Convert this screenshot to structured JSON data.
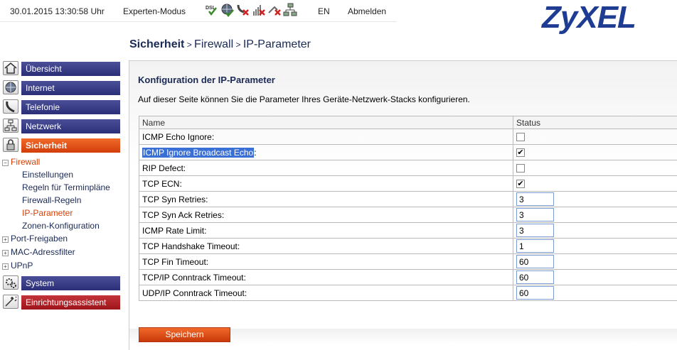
{
  "topbar": {
    "datetime": "30.01.2015 13:30:58 Uhr",
    "mode": "Experten-Modus",
    "status_icons": [
      "dsl-icon",
      "internet-icon",
      "phone-disconnected-icon",
      "wifi-disabled-icon",
      "network-disabled-icon",
      "lan-icon"
    ],
    "language": "EN",
    "logout": "Abmelden"
  },
  "brand": {
    "logo_text": "ZyXEL",
    "color": "#1f3c93"
  },
  "breadcrumb": {
    "part1": "Sicherheit",
    "sep1": " > ",
    "part2": "Firewall",
    "sep2": " > ",
    "part3": "IP-Parameter"
  },
  "sidebar": {
    "main_items": [
      {
        "label": "Übersicht",
        "icon": "home-icon"
      },
      {
        "label": "Internet",
        "icon": "globe-icon"
      },
      {
        "label": "Telefonie",
        "icon": "phone-icon"
      },
      {
        "label": "Netzwerk",
        "icon": "network-icon"
      },
      {
        "label": "Sicherheit",
        "icon": "lock-icon"
      }
    ],
    "firewall_label": "Firewall",
    "firewall_items": [
      "Einstellungen",
      "Regeln für Terminpläne",
      "Firewall-Regeln",
      "IP-Parameter",
      "Zonen-Konfiguration"
    ],
    "collapsed_items": [
      "Port-Freigaben",
      "MAC-Adressfilter",
      "UPnP"
    ],
    "bottom_items": [
      {
        "label": "System",
        "icon": "gears-icon"
      },
      {
        "label": "Einrichtungsassistent",
        "icon": "wand-icon"
      }
    ]
  },
  "main": {
    "title": "Konfiguration der IP-Parameter",
    "description": "Auf dieser Seite können Sie die Parameter Ihres Geräte-Netzwerk-Stacks konfigurieren.",
    "columns": {
      "name": "Name",
      "status": "Status"
    },
    "rows": [
      {
        "name": "ICMP Echo Ignore:",
        "type": "checkbox",
        "checked": false
      },
      {
        "name": "ICMP Ignore Broadcast Echo",
        "suffix": ":",
        "type": "checkbox",
        "checked": true,
        "selected_text": true
      },
      {
        "name": "RIP Defect:",
        "type": "checkbox",
        "checked": false
      },
      {
        "name": "TCP ECN:",
        "type": "checkbox",
        "checked": true
      },
      {
        "name": "TCP Syn Retries:",
        "type": "text",
        "value": "3"
      },
      {
        "name": "TCP Syn Ack Retries:",
        "type": "text",
        "value": "3"
      },
      {
        "name": "ICMP Rate Limit:",
        "type": "text",
        "value": "3"
      },
      {
        "name": "TCP Handshake Timeout:",
        "type": "text",
        "value": "1"
      },
      {
        "name": "TCP Fin Timeout:",
        "type": "text",
        "value": "60"
      },
      {
        "name": "TCP/IP Conntrack Timeout:",
        "type": "text",
        "value": "60"
      },
      {
        "name": "UDP/IP Conntrack Timeout:",
        "type": "text",
        "value": "60"
      }
    ],
    "save_label": "Speichern"
  },
  "colors": {
    "accent_orange": "#d2410a",
    "nav_blue": "#2b2f78",
    "nav_red": "#9d1419"
  }
}
